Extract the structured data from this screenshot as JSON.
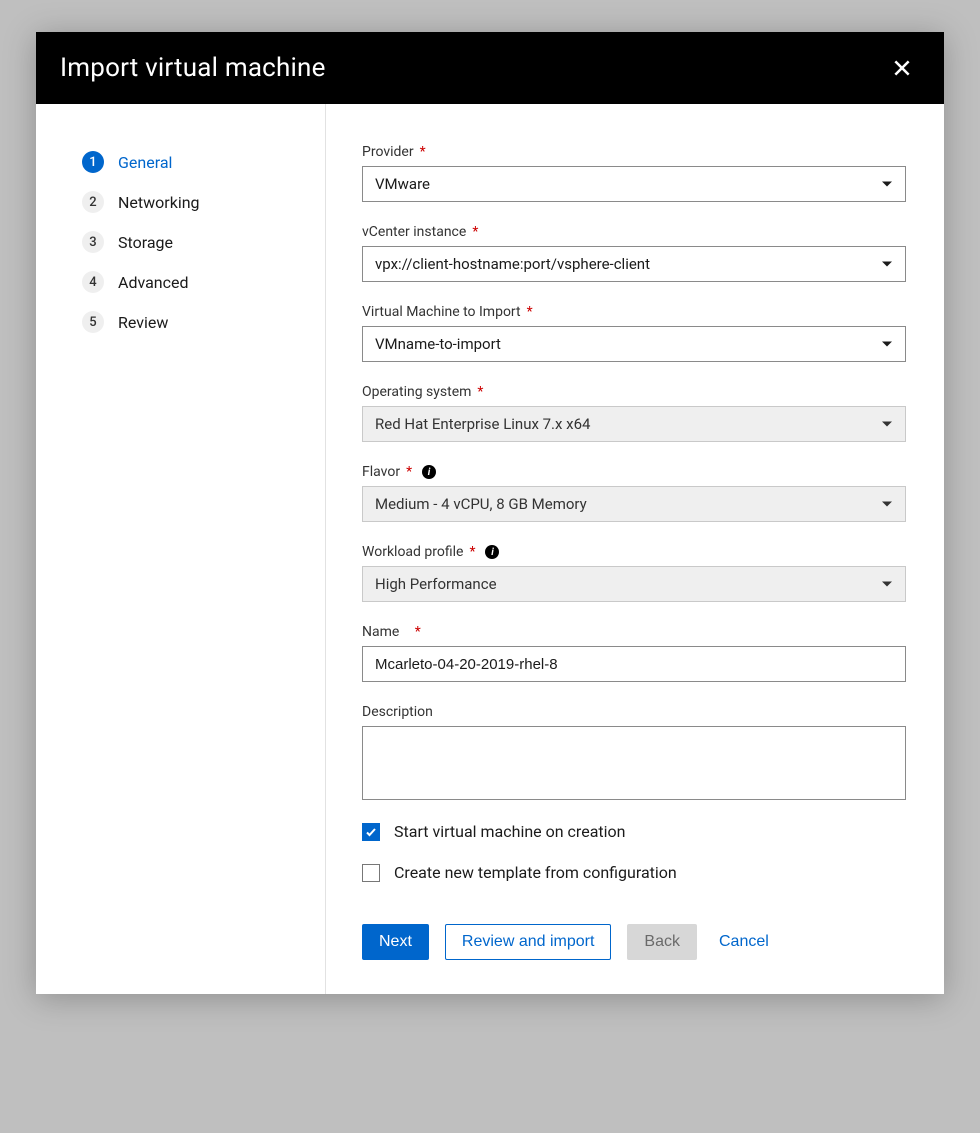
{
  "header": {
    "title": "Import virtual machine"
  },
  "sidebar": {
    "items": [
      {
        "num": "1",
        "label": "General",
        "active": true
      },
      {
        "num": "2",
        "label": "Networking",
        "active": false
      },
      {
        "num": "3",
        "label": "Storage",
        "active": false
      },
      {
        "num": "4",
        "label": "Advanced",
        "active": false
      },
      {
        "num": "5",
        "label": "Review",
        "active": false
      }
    ]
  },
  "form": {
    "provider": {
      "label": "Provider",
      "required": true,
      "value": "VMware"
    },
    "vcenter": {
      "label": "vCenter instance",
      "required": true,
      "value": "vpx://client-hostname:port/vsphere-client"
    },
    "vm": {
      "label": "Virtual Machine to Import",
      "required": true,
      "value": "VMname-to-import"
    },
    "os": {
      "label": "Operating system",
      "required": true,
      "value": "Red Hat Enterprise Linux 7.x x64",
      "locked": true
    },
    "flavor": {
      "label": "Flavor",
      "required": true,
      "value": "Medium - 4 vCPU, 8 GB Memory",
      "info": true,
      "locked": true
    },
    "workload": {
      "label": "Workload profile",
      "required": true,
      "value": "High Performance",
      "info": true,
      "locked": true
    },
    "name": {
      "label": "Name",
      "required": true,
      "value": "Mcarleto-04-20-2019-rhel-8"
    },
    "description": {
      "label": "Description",
      "value": ""
    },
    "start_on_create": {
      "label": "Start virtual machine on creation",
      "checked": true
    },
    "create_template": {
      "label": "Create new template from configuration",
      "checked": false
    }
  },
  "buttons": {
    "next": "Next",
    "review": "Review and import",
    "back": "Back",
    "cancel": "Cancel"
  }
}
